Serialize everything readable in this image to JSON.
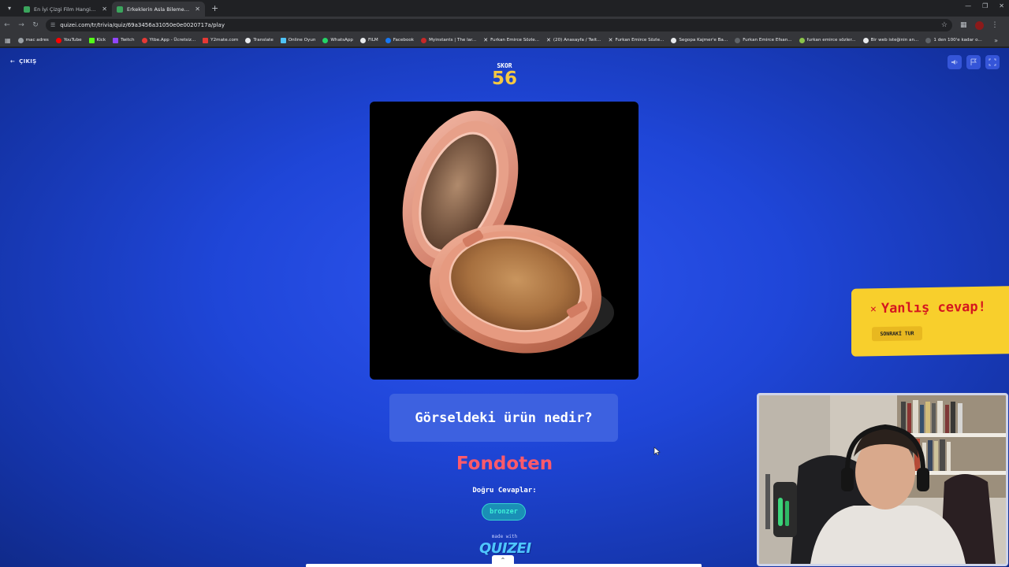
{
  "browser": {
    "tabs": [
      {
        "title": "En İyi Çizgi Film Hangisi? - Tie",
        "favicon_color": "#3ba55d",
        "active": false
      },
      {
        "title": "Erkeklerin Asla Bilemeyeceği Şe",
        "favicon_color": "#3ba55d",
        "active": true
      }
    ],
    "new_tab": "+",
    "url": "quizei.com/tr/trivia/quiz/69a3456a31050e0e0020717a/play",
    "bookmarks": [
      {
        "label": "mac adres",
        "color": "#9aa0a6"
      },
      {
        "label": "YouTube",
        "color": "#ff0000"
      },
      {
        "label": "Kick",
        "color": "#53fc18"
      },
      {
        "label": "Twitch",
        "color": "#9146ff"
      },
      {
        "label": "Ytbe.App - Ücretsiz...",
        "color": "#e53935"
      },
      {
        "label": "Y2mate.com",
        "color": "#e53935"
      },
      {
        "label": "Translate",
        "color": "#e8eaed"
      },
      {
        "label": "Online Oyun",
        "color": "#4fc3f7"
      },
      {
        "label": "WhatsApp",
        "color": "#25d366"
      },
      {
        "label": "FILM",
        "color": "#e8eaed"
      },
      {
        "label": "Facebook",
        "color": "#1877f2"
      },
      {
        "label": "Myinstants | The lar...",
        "color": "#c62828"
      },
      {
        "label": "Furkan Emirce Sözle...",
        "color": "#e8eaed"
      },
      {
        "label": "(20) Anasayfa / Twit...",
        "color": "#e8eaed"
      },
      {
        "label": "Furkan Emirce Sözle...",
        "color": "#e8eaed"
      },
      {
        "label": "Segopa Kajmer'e Ba...",
        "color": "#e8eaed"
      },
      {
        "label": "Furkan Emirce Efsan...",
        "color": "#5f6368"
      },
      {
        "label": "furkan emirce sözler...",
        "color": "#8bc34a"
      },
      {
        "label": "Bir web isteğinin an...",
        "color": "#e8eaed"
      },
      {
        "label": "1 den 100'e kadar o...",
        "color": "#5f6368"
      }
    ]
  },
  "quiz": {
    "exit_label": "ÇIKIŞ",
    "score_label": "SKOR",
    "score_value": "56",
    "question": "Görseldeki ürün nedir?",
    "given_answer": "Fondoten",
    "correct_answers_label": "Doğru Cevaplar:",
    "correct_answers": [
      "bronzer"
    ],
    "made_with": "made with",
    "brand": "QUIZEI",
    "image_subject": "compact-bronzer-icon"
  },
  "feedback": {
    "title": "Yanlış cevap!",
    "next_round": "SONRAKİ TUR"
  },
  "colors": {
    "background": "#1f46d8",
    "score": "#f5c842",
    "wrong_answer": "#ff5a6a",
    "toast": "#f8cf2c",
    "toast_text": "#d5161f",
    "chip_text": "#3df0d8"
  }
}
